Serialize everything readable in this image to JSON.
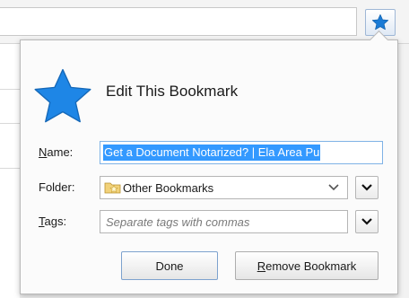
{
  "toolbar": {
    "bookmark_icon": "star-icon",
    "accent": "#1a7bd6"
  },
  "panel": {
    "title": "Edit This Bookmark",
    "icon": "star-icon",
    "name": {
      "label_accesskey": "N",
      "label_rest": "ame:",
      "value": "Get a Document Notarized? | Ela Area Pu"
    },
    "folder": {
      "label": "Folder:",
      "value": "Other Bookmarks",
      "icon": "folder-star-icon"
    },
    "tags": {
      "label_accesskey": "T",
      "label_rest": "ags:",
      "placeholder": "Separate tags with commas"
    },
    "buttons": {
      "done": "Done",
      "remove_accesskey": "R",
      "remove_rest": "emove Bookmark"
    }
  }
}
